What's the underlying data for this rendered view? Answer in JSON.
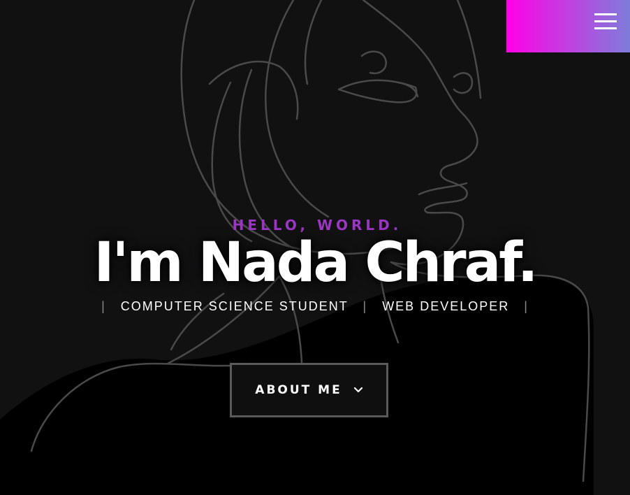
{
  "hero": {
    "greeting": "HELLO, WORLD.",
    "name": "I'm Nada Chraf.",
    "roles": [
      "COMPUTER SCIENCE STUDENT",
      "WEB DEVELOPER"
    ],
    "separator": "|"
  },
  "about_button": {
    "label": "ABOUT ME",
    "icon": "chevron-down-icon"
  },
  "menu": {
    "icon": "hamburger-icon"
  },
  "colors": {
    "background": "#111112",
    "greeting": "#9b35c4",
    "menu_gradient_start": "#ff00e6",
    "menu_gradient_end": "#7f7cdb",
    "line_art": "#4a4a4a"
  }
}
